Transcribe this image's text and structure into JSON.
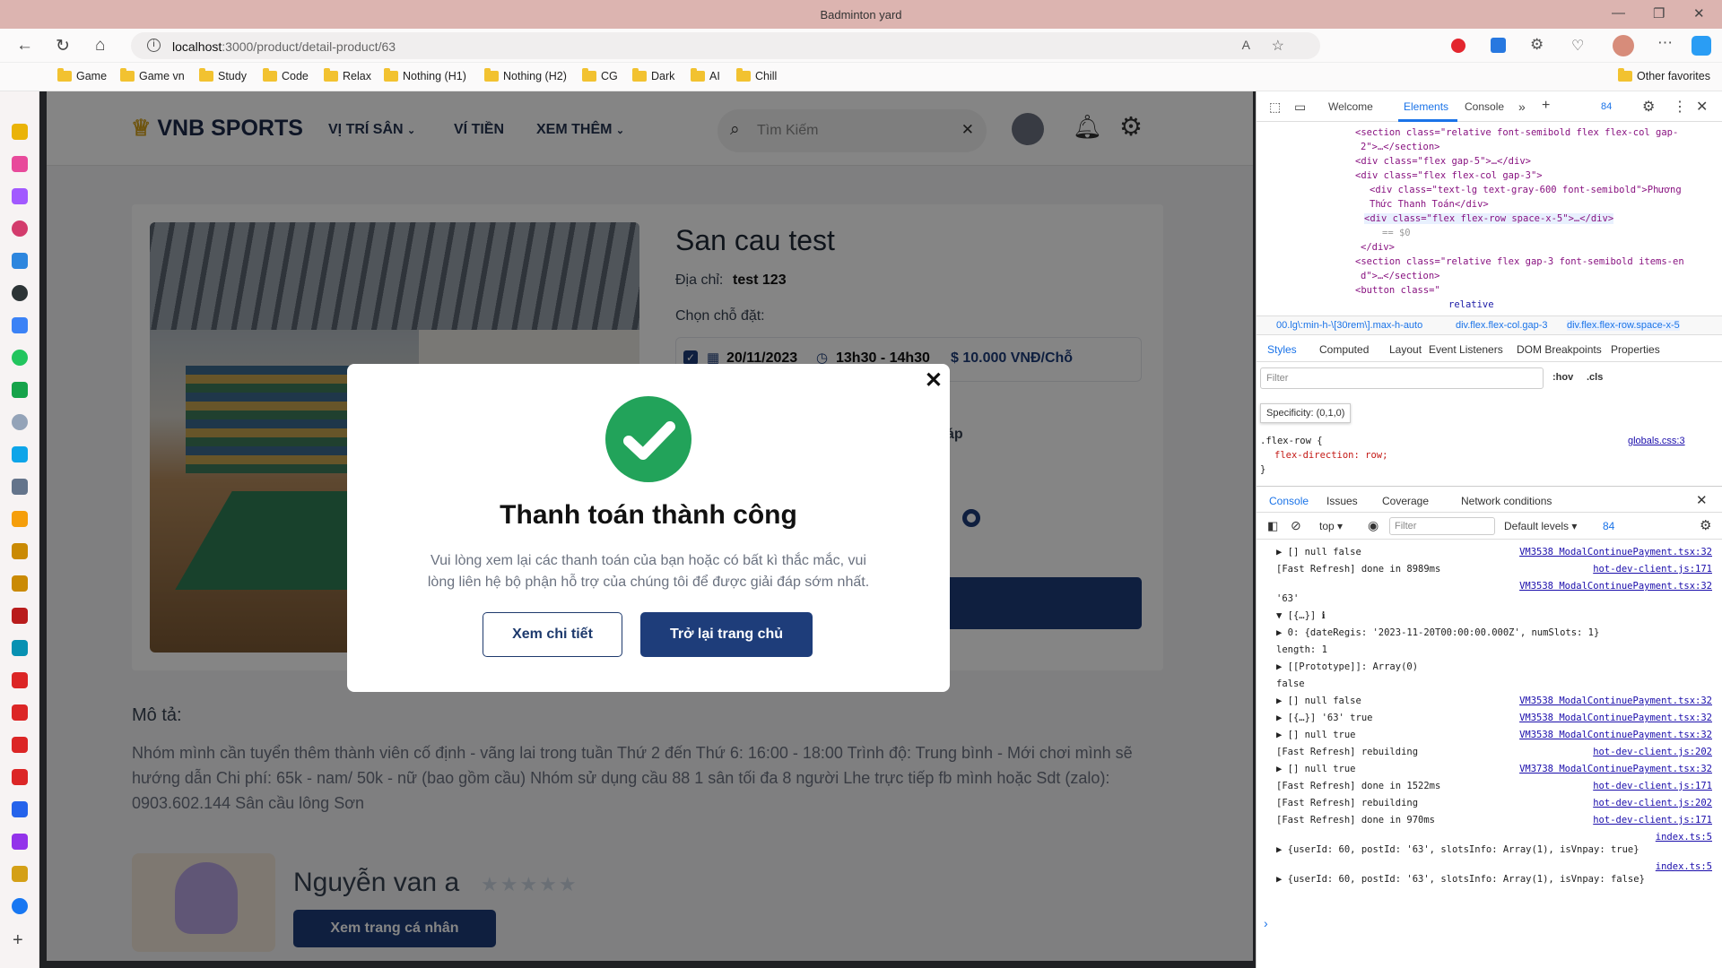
{
  "window": {
    "title": "Badminton yard"
  },
  "browser": {
    "url_host": "localhost",
    "url_path": ":3000/product/detail-product/63",
    "favorites": [
      "Game",
      "Game vn",
      "Study",
      "Code",
      "Relax",
      "Nothing (H1)",
      "Nothing (H2)",
      "CG",
      "Dark",
      "AI",
      "Chill"
    ],
    "other_favorites": "Other favorites"
  },
  "site": {
    "logo": "VNB SPORTS",
    "menu": [
      "VỊ TRÍ SÂN",
      "VÍ TIỀN",
      "XEM THÊM"
    ],
    "search_placeholder": "Tìm Kiếm"
  },
  "product": {
    "title": "San cau test",
    "address_label": "Địa chỉ:",
    "address": "test 123",
    "choose_label": "Chọn chỗ đặt:",
    "slot": {
      "date": "20/11/2023",
      "time": "13h30 - 14h30",
      "price": "$ 10.000 VNĐ/Chỗ"
    },
    "partial_text": "áp"
  },
  "description": {
    "heading": "Mô tả:",
    "text": "Nhóm mình cần tuyển thêm thành viên cố định - vãng lai trong tuần Thứ 2 đến Thứ 6: 16:00 - 18:00 Trình độ: Trung bình - Mới chơi mình sẽ hướng dẫn Chi phí: 65k - nam/ 50k - nữ (bao gồm cầu) Nhóm sử dụng cầu 88 1 sân tối đa 8 người Lhe trực tiếp fb mình hoặc Sdt (zalo): 0903.602.144 Sân cầu lông Sơn"
  },
  "owner": {
    "name": "Nguyễn van a",
    "rating": 0,
    "profile_button": "Xem trang cá nhân"
  },
  "modal": {
    "title": "Thanh toán thành công",
    "message": "Vui lòng xem lại các thanh toán của bạn hoặc có bất kì thắc mắc, vui lòng liên hệ bộ phận hỗ trợ của chúng tôi để được giải đáp sớm nhất.",
    "detail_button": "Xem chi tiết",
    "home_button": "Trở lại trang chủ"
  },
  "devtools": {
    "tabs": [
      "Welcome",
      "Elements",
      "Console"
    ],
    "badge": "84",
    "breadcrumb": [
      "00.lg\\:min-h-\\[30rem\\].max-h-auto",
      "div.flex.flex-col.gap-3",
      "div.flex.flex-row.space-x-5"
    ],
    "styles_tabs": [
      "Styles",
      "Computed",
      "Layout",
      "Event Listeners",
      "DOM Breakpoints",
      "Properties"
    ],
    "filter_placeholder": "Filter",
    "hov": ":hov",
    "cls": ".cls",
    "specificity": "Specificity: (0,1,0)",
    "css_selector": ".flex-row {",
    "css_rule": "flex-direction: row;",
    "css_close": "}",
    "css_source": "globals.css:3",
    "drawer_tabs": [
      "Console",
      "Issues",
      "Coverage",
      "Network conditions"
    ],
    "context": "top",
    "levels": "Default levels",
    "count": "84"
  },
  "elements_lines": [
    "<section class=\"relative font-semibold flex flex-col gap-",
    "2\">…</section>",
    "<div class=\"flex gap-5\">…</div>",
    "<div class=\"flex flex-col gap-3\">",
    "<div class=\"text-lg text-gray-600 font-semibold\">Phương",
    "Thức Thanh Toán</div>",
    "<div class=\"flex flex-row space-x-5\">…</div>",
    "== $0",
    "</div>",
    "<section class=\"relative flex gap-3 font-semibold items-en",
    "d\">…</section>",
    "<button class=\"",
    "relative"
  ],
  "console": [
    {
      "text": "▶ [] null false",
      "src": "VM3538 ModalContinuePayment.tsx:32"
    },
    {
      "text": "[Fast Refresh] done in 8989ms",
      "src": "hot-dev-client.js:171"
    },
    {
      "text": "",
      "src": "VM3538 ModalContinuePayment.tsx:32"
    },
    {
      "text": "'63'",
      "src": ""
    },
    {
      "text": "▼ [{…}] ℹ",
      "src": ""
    },
    {
      "text": "▶ 0: {dateRegis: '2023-11-20T00:00:00.000Z', numSlots: 1}",
      "src": ""
    },
    {
      "text": "length: 1",
      "src": ""
    },
    {
      "text": "▶ [[Prototype]]: Array(0)",
      "src": ""
    },
    {
      "text": "false",
      "src": ""
    },
    {
      "text": "▶ [] null false",
      "src": "VM3538 ModalContinuePayment.tsx:32"
    },
    {
      "text": "▶ [{…}] '63' true",
      "src": "VM3538 ModalContinuePayment.tsx:32"
    },
    {
      "text": "▶ [] null true",
      "src": "VM3538 ModalContinuePayment.tsx:32"
    },
    {
      "text": "[Fast Refresh] rebuilding",
      "src": "hot-dev-client.js:202"
    },
    {
      "text": "▶ [] null true",
      "src": "VM3738 ModalContinuePayment.tsx:32"
    },
    {
      "text": "[Fast Refresh] done in 1522ms",
      "src": "hot-dev-client.js:171"
    },
    {
      "text": "[Fast Refresh] rebuilding",
      "src": "hot-dev-client.js:202"
    },
    {
      "text": "[Fast Refresh] done in 970ms",
      "src": "hot-dev-client.js:171"
    },
    {
      "text": "",
      "src": "index.ts:5"
    },
    {
      "text": "▶ {userId: 60, postId: '63', slotsInfo: Array(1), isVnpay: true}",
      "src": ""
    },
    {
      "text": "",
      "src": "index.ts:5"
    },
    {
      "text": "▶ {userId: 60, postId: '63', slotsInfo: Array(1), isVnpay: false}",
      "src": ""
    }
  ],
  "colors": {
    "brand": "#1e3d7a",
    "success": "#22a35a",
    "titlebar": "#dcb4b0"
  },
  "icons": [
    "back-icon",
    "refresh-icon",
    "home-icon",
    "star-icon",
    "bell-icon",
    "gear-icon",
    "search-icon",
    "close-icon",
    "check-circle-icon",
    "calendar-icon",
    "clock-icon",
    "checkbox-icon"
  ]
}
